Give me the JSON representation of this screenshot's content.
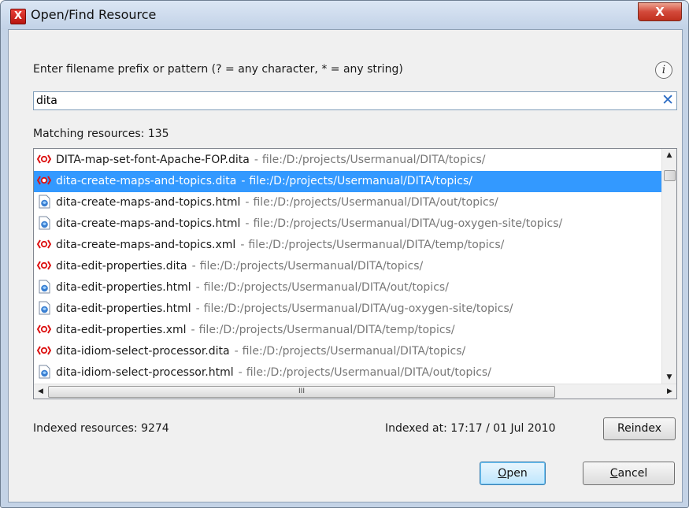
{
  "window": {
    "title": "Open/Find Resource",
    "close_symbol": "X",
    "app_icon_letter": "X"
  },
  "prompt": {
    "label": "Enter filename prefix or pattern (? = any character, * = any string)",
    "info_symbol": "i"
  },
  "search": {
    "value": "dita",
    "clear_symbol": "✕"
  },
  "matching": {
    "label": "Matching resources: 135"
  },
  "results": {
    "selected_index": 1,
    "items": [
      {
        "name": "DITA-map-set-font-Apache-FOP.dita",
        "path": "file:/D:/projects/Usermanual/DITA/topics/",
        "icon": "dita-xml-icon"
      },
      {
        "name": "dita-create-maps-and-topics.dita",
        "path": "file:/D:/projects/Usermanual/DITA/topics/",
        "icon": "dita-xml-icon"
      },
      {
        "name": "dita-create-maps-and-topics.html",
        "path": "file:/D:/projects/Usermanual/DITA/out/topics/",
        "icon": "html-file-icon"
      },
      {
        "name": "dita-create-maps-and-topics.html",
        "path": "file:/D:/projects/Usermanual/DITA/ug-oxygen-site/topics/",
        "icon": "html-file-icon"
      },
      {
        "name": "dita-create-maps-and-topics.xml",
        "path": "file:/D:/projects/Usermanual/DITA/temp/topics/",
        "icon": "dita-xml-icon"
      },
      {
        "name": "dita-edit-properties.dita",
        "path": "file:/D:/projects/Usermanual/DITA/topics/",
        "icon": "dita-xml-icon"
      },
      {
        "name": "dita-edit-properties.html",
        "path": "file:/D:/projects/Usermanual/DITA/out/topics/",
        "icon": "html-file-icon"
      },
      {
        "name": "dita-edit-properties.html",
        "path": "file:/D:/projects/Usermanual/DITA/ug-oxygen-site/topics/",
        "icon": "html-file-icon"
      },
      {
        "name": "dita-edit-properties.xml",
        "path": "file:/D:/projects/Usermanual/DITA/temp/topics/",
        "icon": "dita-xml-icon"
      },
      {
        "name": "dita-idiom-select-processor.dita",
        "path": "file:/D:/projects/Usermanual/DITA/topics/",
        "icon": "dita-xml-icon"
      },
      {
        "name": "dita-idiom-select-processor.html",
        "path": "file:/D:/projects/Usermanual/DITA/out/topics/",
        "icon": "html-file-icon"
      }
    ],
    "separator": "-",
    "scroll": {
      "up": "▲",
      "down": "▼",
      "left": "◀",
      "right": "▶",
      "grip": "III"
    }
  },
  "footer": {
    "indexed_resources": "Indexed resources: 9274",
    "indexed_at": "Indexed at: 17:17 / 01 Jul 2010",
    "reindex_label": "Reindex",
    "open_label": "Open",
    "cancel_label": "Cancel"
  }
}
